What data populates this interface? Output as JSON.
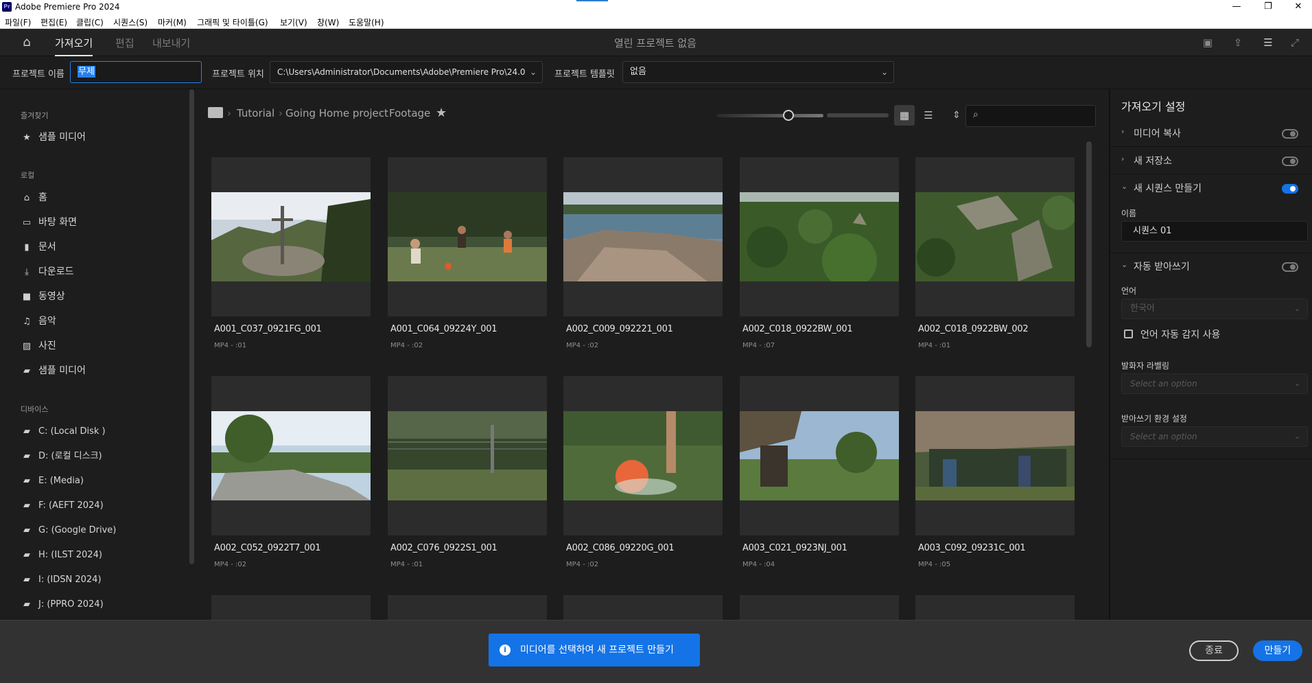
{
  "titlebar": {
    "logo": "Pr",
    "title": "Adobe Premiere Pro 2024"
  },
  "menu": [
    "파일(F)",
    "편집(E)",
    "클립(C)",
    "시퀀스(S)",
    "마커(M)",
    "그래픽 및 타이틀(G)",
    "보기(V)",
    "창(W)",
    "도움말(H)"
  ],
  "header": {
    "tabs": [
      "가져오기",
      "편집",
      "내보내기"
    ],
    "center_title": "열린 프로젝트 없음"
  },
  "project": {
    "name_label": "프로젝트 이름",
    "name_value": "무제",
    "location_label": "프로젝트 위치",
    "location_value": "C:\\Users\\Administrator\\Documents\\Adobe\\Premiere Pro\\24.0",
    "template_label": "프로젝트 템플릿",
    "template_value": "없음"
  },
  "sidebar": {
    "favorites_label": "즐겨찾기",
    "favorites": [
      {
        "label": "샘플 미디어",
        "icon": "star-icon"
      }
    ],
    "local_label": "로컬",
    "local": [
      {
        "label": "홈",
        "icon": "home-icon"
      },
      {
        "label": "바탕 화면",
        "icon": "monitor-icon"
      },
      {
        "label": "문서",
        "icon": "document-icon"
      },
      {
        "label": "다운로드",
        "icon": "download-icon"
      },
      {
        "label": "동영상",
        "icon": "video-icon"
      },
      {
        "label": "음악",
        "icon": "music-icon"
      },
      {
        "label": "사진",
        "icon": "image-icon"
      },
      {
        "label": "샘플 미디어",
        "icon": "folder-icon"
      }
    ],
    "devices_label": "디바이스",
    "devices": [
      {
        "label": "C: (Local Disk )",
        "icon": "folder-icon"
      },
      {
        "label": "D: (로컬 디스크)",
        "icon": "folder-icon"
      },
      {
        "label": "E: (Media)",
        "icon": "folder-icon"
      },
      {
        "label": "F: (AEFT 2024)",
        "icon": "folder-icon"
      },
      {
        "label": "G: (Google Drive)",
        "icon": "folder-icon"
      },
      {
        "label": "H: (ILST 2024)",
        "icon": "folder-icon"
      },
      {
        "label": "I: (IDSN 2024)",
        "icon": "folder-icon"
      },
      {
        "label": "J: (PPRO 2024)",
        "icon": "folder-icon"
      }
    ]
  },
  "breadcrumb": [
    "Tutorial",
    "Going Home project",
    "Footage"
  ],
  "media": [
    {
      "name": "A001_C037_0921FG_001",
      "meta": "MP4 - :01"
    },
    {
      "name": "A001_C064_09224Y_001",
      "meta": "MP4 - :02"
    },
    {
      "name": "A002_C009_092221_001",
      "meta": "MP4 - :02"
    },
    {
      "name": "A002_C018_0922BW_001",
      "meta": "MP4 - :07"
    },
    {
      "name": "A002_C018_0922BW_002",
      "meta": "MP4 - :01"
    },
    {
      "name": "A002_C052_0922T7_001",
      "meta": "MP4 - :02"
    },
    {
      "name": "A002_C076_0922S1_001",
      "meta": "MP4 - :01"
    },
    {
      "name": "A002_C086_09220G_001",
      "meta": "MP4 - :02"
    },
    {
      "name": "A003_C021_0923NJ_001",
      "meta": "MP4 - :04"
    },
    {
      "name": "A003_C092_09231C_001",
      "meta": "MP4 - :05"
    }
  ],
  "settings": {
    "title": "가져오기 설정",
    "copy_media": "미디어 복사",
    "new_bin": "새 저장소",
    "new_sequence": "새 시퀀스 만들기",
    "name_label": "이름",
    "name_value": "시퀀스 01",
    "auto_transcribe": "자동 받아쓰기",
    "language_label": "언어",
    "language_value": "한국어",
    "auto_detect": "언어 자동 감지 사용",
    "speaker_label": "발화자 라벨링",
    "speaker_placeholder": "Select an option",
    "transcribe_pref_label": "받아쓰기 환경 설정",
    "transcribe_pref_placeholder": "Select an option"
  },
  "bottom": {
    "toast": "미디어를 선택하여 새 프로젝트 만들기",
    "close": "종료",
    "create": "만들기"
  },
  "colors": {
    "accent": "#1473e6",
    "background": "#1d1d1d"
  }
}
